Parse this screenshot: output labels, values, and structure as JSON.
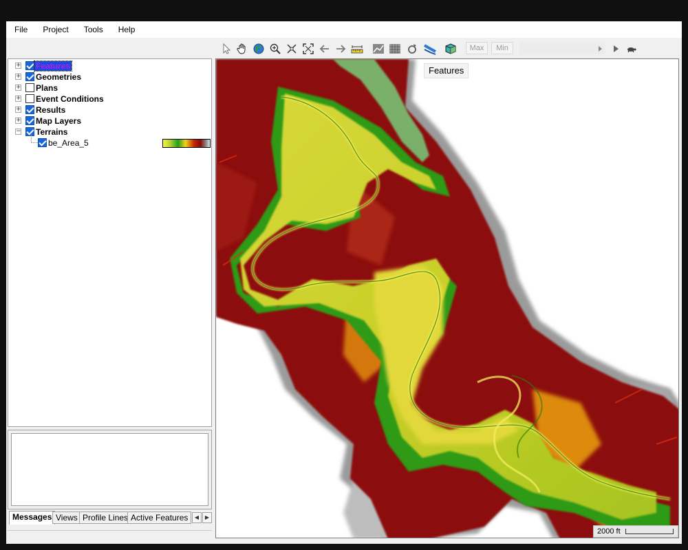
{
  "menu": [
    "File",
    "Project",
    "Tools",
    "Help"
  ],
  "toolbar": {
    "icons": [
      "select-arrow-icon",
      "pan-hand-icon",
      "globe-icon",
      "zoom-in-icon",
      "zoom-extent-icon",
      "full-extent-icon",
      "back-arrow-icon",
      "forward-arrow-icon",
      "measure-ruler-icon",
      "profile-line-icon",
      "grid-icon",
      "reload-icon",
      "river-layer-icon",
      "3d-cube-icon",
      "step-back-icon",
      "step-forward-icon",
      "play-icon",
      "turtle-icon"
    ],
    "max_label": "Max",
    "min_label": "Min"
  },
  "tree": [
    {
      "label": "Features",
      "checked": true,
      "expanded": false,
      "selected": true
    },
    {
      "label": "Geometries",
      "checked": true,
      "expanded": false
    },
    {
      "label": "Plans",
      "checked": false,
      "expanded": false
    },
    {
      "label": "Event Conditions",
      "checked": false,
      "expanded": false
    },
    {
      "label": "Results",
      "checked": true,
      "expanded": false
    },
    {
      "label": "Map Layers",
      "checked": true,
      "expanded": false
    },
    {
      "label": "Terrains",
      "checked": true,
      "expanded": true
    }
  ],
  "terrain_child": {
    "label": "be_Area_5",
    "checked": true
  },
  "tabs": [
    "Messages",
    "Views",
    "Profile Lines",
    "Active Features"
  ],
  "map": {
    "title": "Features",
    "scale_label": "2000 ft"
  },
  "colors": {
    "selection": "#1a4ad9",
    "checkbox": "#1a66d9",
    "terrain_low": "#f5f54a",
    "terrain_mid": "#22a01e",
    "terrain_high": "#8a0a0a",
    "terrain_peak": "#9a9a9a"
  }
}
